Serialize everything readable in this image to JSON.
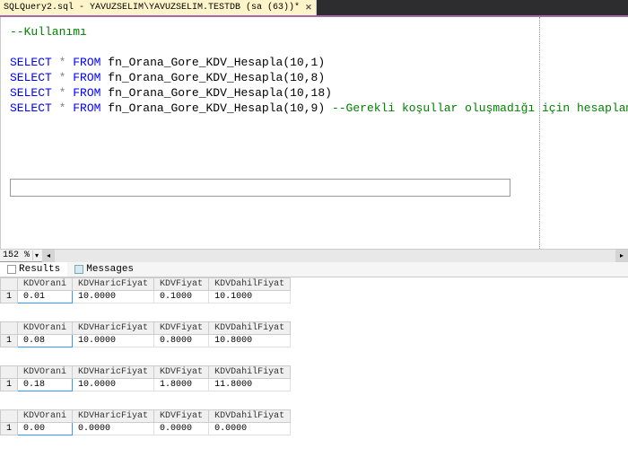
{
  "tab": {
    "title": "SQLQuery2.sql - YAVUZSELIM\\YAVUZSELIM.TESTDB (sa (63))*"
  },
  "code": {
    "comment1": "--Kullanımı",
    "sel": "SELECT",
    "star": "*",
    "from": "FROM",
    "fn1": "fn_Orana_Gore_KDV_Hesapla(10,1)",
    "fn2": "fn_Orana_Gore_KDV_Hesapla(10,8)",
    "fn3": "fn_Orana_Gore_KDV_Hesapla(10,18)",
    "fn4": "fn_Orana_Gore_KDV_Hesapla(10,9)",
    "comment2": "--Gerekli koşullar oluşmadığı için hesaplamadı."
  },
  "zoom": "152 %",
  "tabs": {
    "results": "Results",
    "messages": "Messages"
  },
  "headers": {
    "c1": "KDVOrani",
    "c2": "KDVHaricFiyat",
    "c3": "KDVFiyat",
    "c4": "KDVDahilFiyat"
  },
  "rows": [
    {
      "n": "1",
      "c1": "0.01",
      "c2": "10.0000",
      "c3": "0.1000",
      "c4": "10.1000"
    },
    {
      "n": "1",
      "c1": "0.08",
      "c2": "10.0000",
      "c3": "0.8000",
      "c4": "10.8000"
    },
    {
      "n": "1",
      "c1": "0.18",
      "c2": "10.0000",
      "c3": "1.8000",
      "c4": "11.8000"
    },
    {
      "n": "1",
      "c1": "0.00",
      "c2": "0.0000",
      "c3": "0.0000",
      "c4": "0.0000"
    }
  ]
}
